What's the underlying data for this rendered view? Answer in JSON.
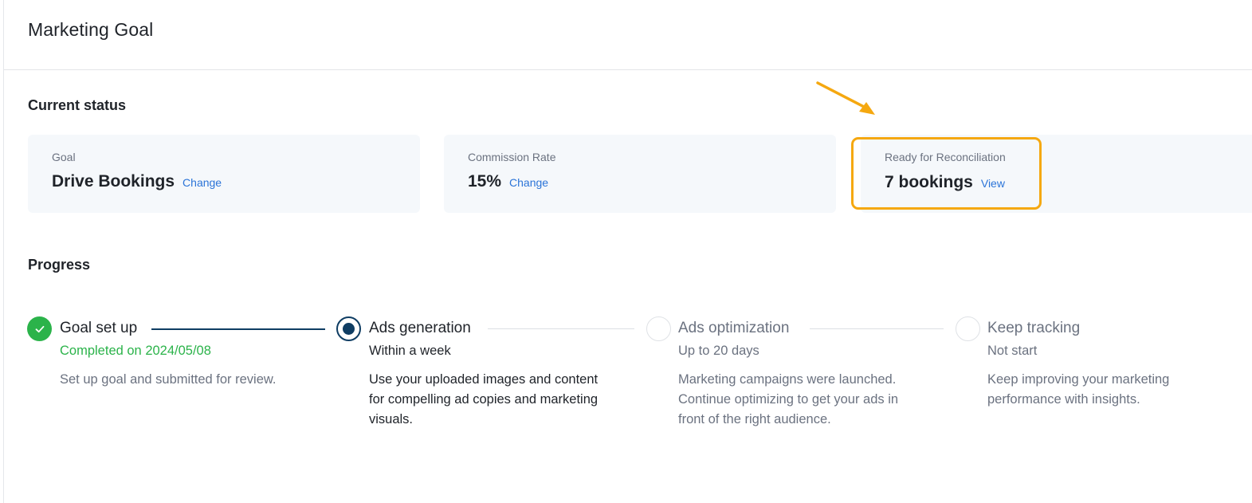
{
  "header": {
    "title": "Marketing Goal"
  },
  "current_status": {
    "title": "Current status",
    "goal": {
      "label": "Goal",
      "value": "Drive Bookings",
      "action": "Change"
    },
    "commission": {
      "label": "Commission Rate",
      "value": "15%",
      "action": "Change"
    },
    "reconciliation": {
      "label": "Ready for Reconciliation",
      "value": "7 bookings",
      "action": "View"
    }
  },
  "progress": {
    "title": "Progress",
    "steps": [
      {
        "title": "Goal set up",
        "status": "completed",
        "subtitle": "Completed on 2024/05/08",
        "lines": [
          "Set up goal and submitted for review."
        ]
      },
      {
        "title": "Ads generation",
        "status": "current",
        "subtitle": "Within a week",
        "lines": [
          "Use your uploaded images and content",
          "for compelling ad copies and marketing",
          "visuals."
        ]
      },
      {
        "title": "Ads optimization",
        "status": "pending",
        "subtitle": "Up to 20 days",
        "lines": [
          "Marketing campaigns were launched.",
          "Continue optimizing to get your ads in",
          "front of the right audience."
        ]
      },
      {
        "title": "Keep tracking",
        "status": "pending",
        "subtitle": "Not start",
        "lines": [
          "Keep improving your marketing",
          "performance with insights."
        ]
      }
    ]
  },
  "colors": {
    "highlight": "#f5a810",
    "success": "#2bb34a",
    "primary_dark": "#0f3d63",
    "link": "#2b74d8"
  }
}
